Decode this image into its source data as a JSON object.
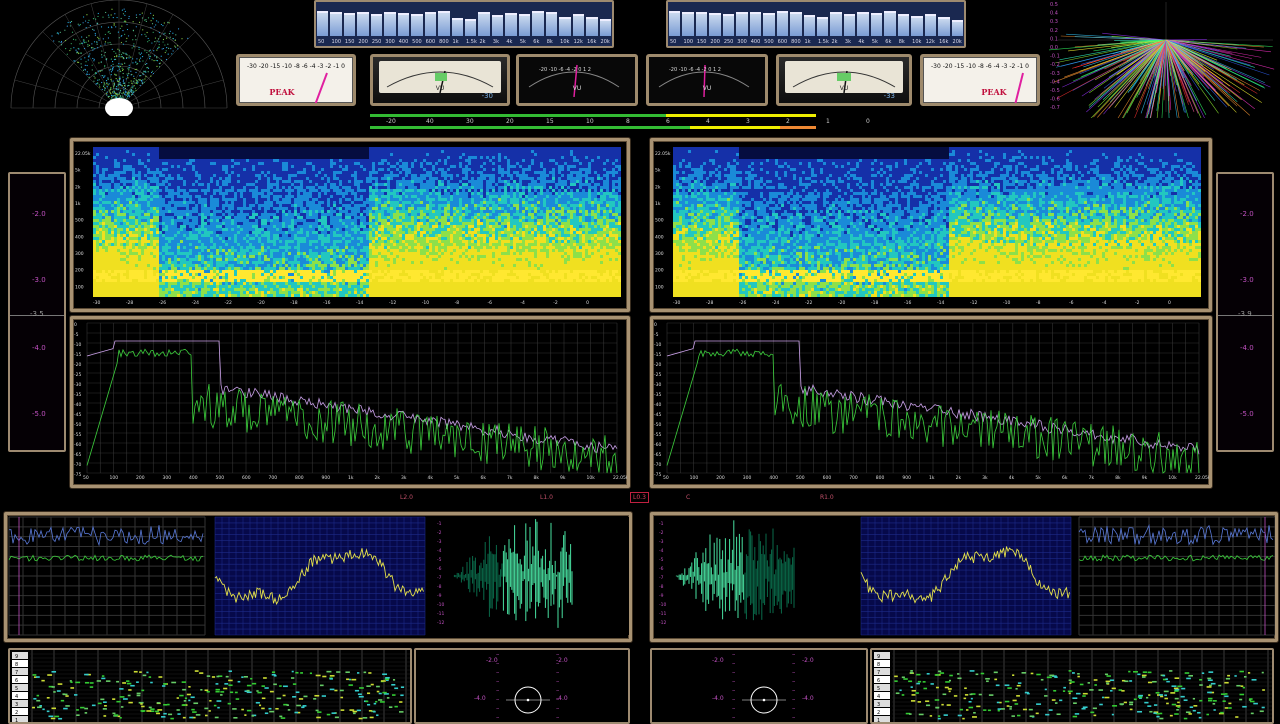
{
  "eq_left": {
    "freqs": [
      "50",
      "100",
      "150",
      "200",
      "250",
      "300",
      "400",
      "500",
      "600",
      "800",
      "1k",
      "1.5k",
      "2k",
      "3k",
      "4k",
      "5k",
      "6k",
      "8k",
      "10k",
      "12k",
      "16k",
      "20k"
    ],
    "levels": [
      0.78,
      0.72,
      0.7,
      0.72,
      0.68,
      0.74,
      0.7,
      0.66,
      0.72,
      0.76,
      0.55,
      0.5,
      0.72,
      0.62,
      0.7,
      0.66,
      0.78,
      0.72,
      0.56,
      0.66,
      0.58,
      0.5
    ]
  },
  "eq_right": {
    "freqs": [
      "50",
      "100",
      "150",
      "200",
      "250",
      "300",
      "400",
      "500",
      "600",
      "800",
      "1k",
      "1.5k",
      "2k",
      "3k",
      "4k",
      "5k",
      "6k",
      "8k",
      "10k",
      "12k",
      "16k",
      "20k"
    ],
    "levels": [
      0.76,
      0.74,
      0.72,
      0.7,
      0.68,
      0.72,
      0.74,
      0.7,
      0.76,
      0.74,
      0.62,
      0.58,
      0.74,
      0.66,
      0.72,
      0.7,
      0.76,
      0.68,
      0.6,
      0.68,
      0.56,
      0.48
    ]
  },
  "meters": {
    "peak_left": {
      "scale": "-30 -20 -15 -10 -8 -6 -4 -3 -2 -1 0",
      "label": "PEAK"
    },
    "peak_right": {
      "scale": "-30 -20 -15 -10 -8 -6 -4 -3 -2 -1 0",
      "label": "PEAK"
    },
    "vu1": {
      "label": "VU",
      "readout": "-30"
    },
    "vu2": {
      "label": "VU",
      "readout": "ᴴᴸ ᴮᴰ"
    },
    "vu3": {
      "label": "VU",
      "readout": "ᴴᴸ ᴮᴰ"
    },
    "vu4": {
      "label": "VU",
      "readout": "-33"
    }
  },
  "bar_scale": [
    "-20",
    "40",
    "30",
    "20",
    "15",
    "10",
    "8",
    "6",
    "4",
    "3",
    "2",
    "1",
    "0"
  ],
  "side_left": [
    "-2.0",
    "-3.0",
    "-3.5",
    "-4.0",
    "-5.0"
  ],
  "side_right": [
    "-2.0",
    "-3.0",
    "-3.9",
    "-4.0",
    "-5.0"
  ],
  "spec_left": {
    "y_ticks": [
      "22.05k",
      "5k",
      "2k",
      "1k",
      "500",
      "400",
      "300",
      "200",
      "100"
    ],
    "x_ticks": [
      "-30",
      "-28",
      "-26",
      "-24",
      "-22",
      "-20",
      "-18",
      "-16",
      "-14",
      "-12",
      "-10",
      "-8",
      "-6",
      "-4",
      "-2",
      "0"
    ]
  },
  "spec_right": {
    "y_ticks": [
      "22.05k",
      "5k",
      "2k",
      "1k",
      "500",
      "400",
      "300",
      "200",
      "100"
    ],
    "x_ticks": [
      "-30",
      "-28",
      "-26",
      "-24",
      "-22",
      "-20",
      "-18",
      "-16",
      "-14",
      "-12",
      "-10",
      "-8",
      "-6",
      "-4",
      "-2",
      "0"
    ]
  },
  "fft_left": {
    "y_ticks": [
      "0",
      "-5",
      "-10",
      "-15",
      "-20",
      "-25",
      "-30",
      "-35",
      "-40",
      "-45",
      "-50",
      "-55",
      "-60",
      "-65",
      "-70",
      "-75"
    ],
    "x_ticks": [
      "50",
      "100",
      "200",
      "300",
      "400",
      "500",
      "600",
      "700",
      "800",
      "900",
      "1k",
      "2k",
      "3k",
      "4k",
      "5k",
      "6k",
      "7k",
      "8k",
      "9k",
      "10k",
      "22.05k"
    ]
  },
  "fft_right": {
    "y_ticks": [
      "0",
      "-5",
      "-10",
      "-15",
      "-20",
      "-25",
      "-30",
      "-35",
      "-40",
      "-45",
      "-50",
      "-55",
      "-60",
      "-65",
      "-70",
      "-75"
    ],
    "x_ticks": [
      "50",
      "100",
      "200",
      "300",
      "400",
      "500",
      "600",
      "700",
      "800",
      "900",
      "1k",
      "2k",
      "3k",
      "4k",
      "5k",
      "6k",
      "7k",
      "8k",
      "9k",
      "10k",
      "22.05k"
    ]
  },
  "balance": {
    "labels": [
      "L2.0",
      "L1.0",
      "L0.3",
      "C",
      "R1.0"
    ],
    "active": "L0.3"
  },
  "wave_ticks": [
    "-1",
    "-2",
    "-3",
    "-4",
    "-5",
    "-6",
    "-7",
    "-8",
    "-9",
    "-10",
    "-11",
    "-12"
  ],
  "scope_ticks": [
    "-2.0",
    "-4.0",
    "-2.0",
    "-4.0"
  ],
  "colors": {
    "frame_gold": "#a89272",
    "magenta": "#c050c0",
    "green": "#3ccf3c",
    "violet": "#c9a0e8",
    "yellow": "#e4e04a",
    "blue": "#5a7ad8"
  }
}
